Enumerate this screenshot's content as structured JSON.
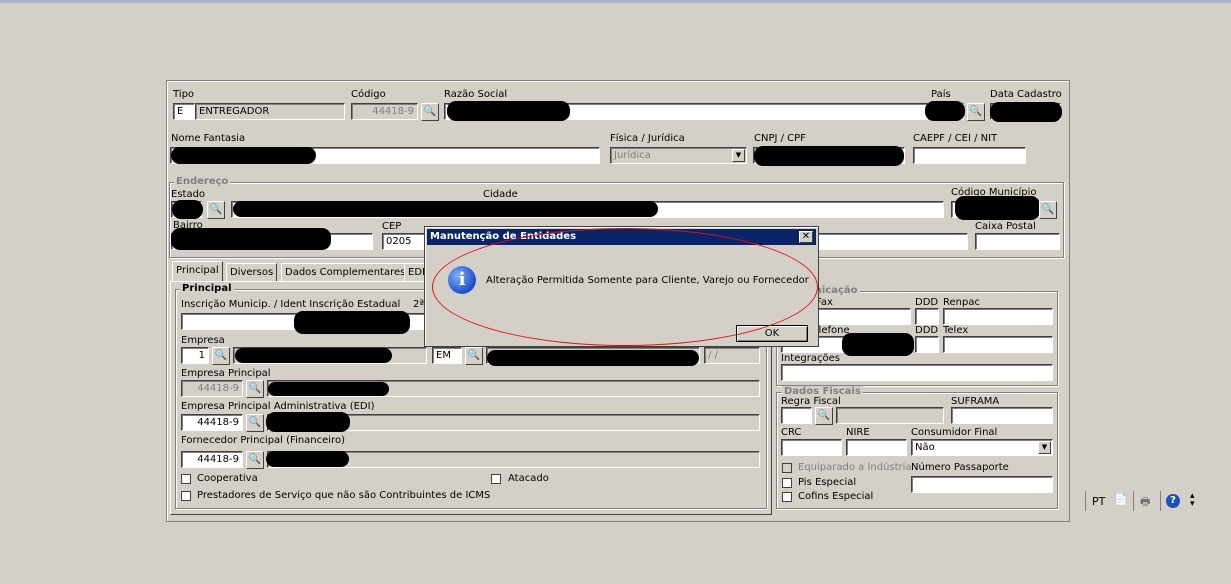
{
  "header": {
    "tipo_label": "Tipo",
    "tipo_code": "E",
    "tipo_value": "ENTREGADOR",
    "codigo_label": "Código",
    "codigo_value": "44418-9",
    "razao_label": "Razão Social",
    "pais_label": "País",
    "data_cadastro_label": "Data Cadastro"
  },
  "row2": {
    "nome_fantasia_label": "Nome Fantasia",
    "fisica_juridica_label": "Física / Jurídica",
    "fisica_juridica_value": "Jurídica",
    "cnpj_label": "CNPJ / CPF",
    "caepf_label": "CAEPF / CEI / NIT"
  },
  "endereco": {
    "group_title": "Endereço",
    "estado_label": "Estado",
    "cidade_label": "Cidade",
    "codigo_municipio_label": "Código Município",
    "bairro_label": "Bairro",
    "cep_label": "CEP",
    "cep_value": "0205",
    "caixa_postal_label": "Caixa Postal"
  },
  "tabs": [
    "Principal",
    "Diversos",
    "Dados Complementares",
    "EDI"
  ],
  "principal": {
    "group_title": "Principal",
    "insc_label": "Inscrição Municip. / Ident Inscrição Estadual",
    "insc_extra": "2ª",
    "empresa_label": "Empresa",
    "empresa_value": "1",
    "em_value": "EM",
    "date_value": "/ /",
    "empresa_principal_label": "Empresa Principal",
    "empresa_principal_value": "44418-9",
    "empresa_adm_label": "Empresa Principal Administrativa (EDI)",
    "empresa_adm_value": "44418-9",
    "fornecedor_label": "Fornecedor Principal (Financeiro)",
    "fornecedor_value": "44418-9",
    "cooperativa_label": "Cooperativa",
    "atacado_label": "Atacado",
    "prestadores_label": "Prestadores de Serviço que não são Contribuintes de ICMS"
  },
  "comunicacao": {
    "group_title": "Comunicação",
    "fax_label": "Fax",
    "ddd_label": "DDD",
    "renpac_label": "Renpac",
    "telefone_label": "Telefone",
    "ddd2_label": "DDD",
    "telex_label": "Telex",
    "integracoes_label": "Integrações"
  },
  "fiscais": {
    "group_title": "Dados Fiscais",
    "regra_fiscal_label": "Regra Fiscal",
    "suframa_label": "SUFRAMA",
    "crc_label": "CRC",
    "nire_label": "NIRE",
    "consumidor_final_label": "Consumidor Final",
    "consumidor_final_value": "Não",
    "equiparado_label": "Equiparado a Indústria",
    "passaporte_label": "Número Passaporte",
    "pis_label": "Pis Especial",
    "cofins_label": "Cofins Especial"
  },
  "dialog": {
    "title": "Manutenção de Entidades",
    "message": "Alteração Permitida Somente para Cliente, Varejo ou Fornecedor",
    "ok_label": "OK",
    "close_glyph": "✕"
  },
  "toolbar": {
    "language": "PT"
  },
  "icons": {
    "binoculars": "binoculars-icon",
    "info": "info-icon"
  }
}
